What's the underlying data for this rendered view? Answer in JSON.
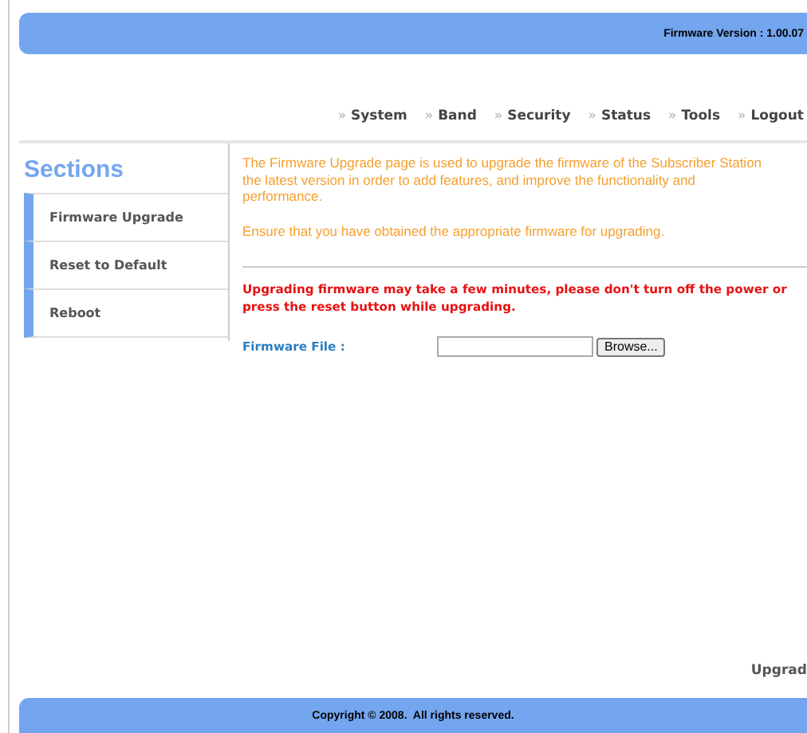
{
  "header": {
    "firmware_version": "Firmware Version : 1.00.07"
  },
  "nav": [
    {
      "label": "System"
    },
    {
      "label": "Band"
    },
    {
      "label": "Security"
    },
    {
      "label": "Status"
    },
    {
      "label": "Tools"
    },
    {
      "label": "Logout"
    }
  ],
  "nav_marker": "»",
  "sidebar": {
    "title": "Sections",
    "items": [
      {
        "label": "Firmware Upgrade"
      },
      {
        "label": "Reset to Default"
      },
      {
        "label": "Reboot"
      }
    ]
  },
  "content": {
    "intro_lines": [
      "The Firmware Upgrade page is used to upgrade the firmware of the Subscriber Station",
      "the latest version in order to add features, and improve the functionality and",
      "performance."
    ],
    "note": "Ensure that you have obtained the appropriate firmware for upgrading.",
    "warning_lines": [
      "Upgrading firmware may take a few minutes, please don't turn off the power or",
      "press the reset button while upgrading."
    ],
    "file_label": "Firmware File :",
    "browse_button": "Browse...",
    "upgrade_button": "Upgrad"
  },
  "footer": "Copyright © 2008.  All rights reserved."
}
